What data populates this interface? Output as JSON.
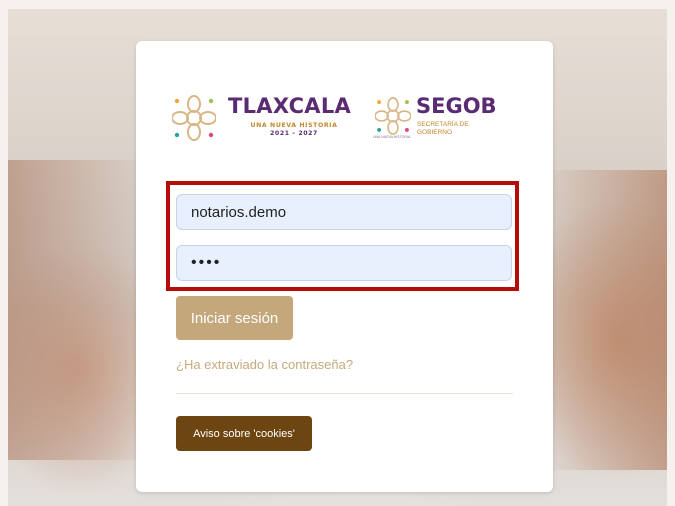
{
  "header": {
    "tlaxcala_title": "TLAXCALA",
    "tlaxcala_subtitle_line1": "UNA NUEVA HISTORIA",
    "tlaxcala_subtitle_line2": "2021 - 2027",
    "segob_title": "SEGOB",
    "segob_subtitle_line1": "SECRETARÍA DE",
    "segob_subtitle_line2": "GOBIERNO",
    "segob_tiny": "UNA NUEVA HISTORIA"
  },
  "form": {
    "username_value": "notarios.demo",
    "password_value": "••••",
    "login_label": "Iniciar sesión",
    "forgot_label": "¿Ha extraviado la contraseña?",
    "cookies_label": "Aviso sobre 'cookies'"
  },
  "colors": {
    "brand_purple": "#5a2a73",
    "brand_gold": "#c4a77a",
    "cookies_brown": "#6d4510",
    "highlight_red": "#b50b0b",
    "input_bg": "#e8effd"
  },
  "icons": {
    "tlaxcala_logo": "flower-knot-icon",
    "segob_logo": "flower-knot-icon"
  }
}
